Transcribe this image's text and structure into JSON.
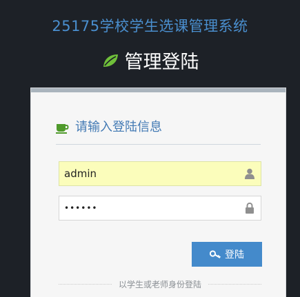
{
  "app": {
    "title": "25175学校学生选课管理系统",
    "heading": "管理登陆"
  },
  "form": {
    "header_label": "请输入登陆信息",
    "username": {
      "value": "admin",
      "icon": "user-icon"
    },
    "password": {
      "value": "••••••",
      "icon": "lock-icon"
    },
    "login_button": {
      "label": "登陆",
      "icon": "key-icon"
    },
    "alt_login_link": "以学生或老师身份登陆"
  },
  "colors": {
    "background": "#1d2127",
    "title_blue": "#4a8fcf",
    "button_blue": "#448acb",
    "leaf_green": "#6fbf3a",
    "cup_green": "#4f9a2b",
    "autofill_yellow": "#fbfdbb"
  }
}
